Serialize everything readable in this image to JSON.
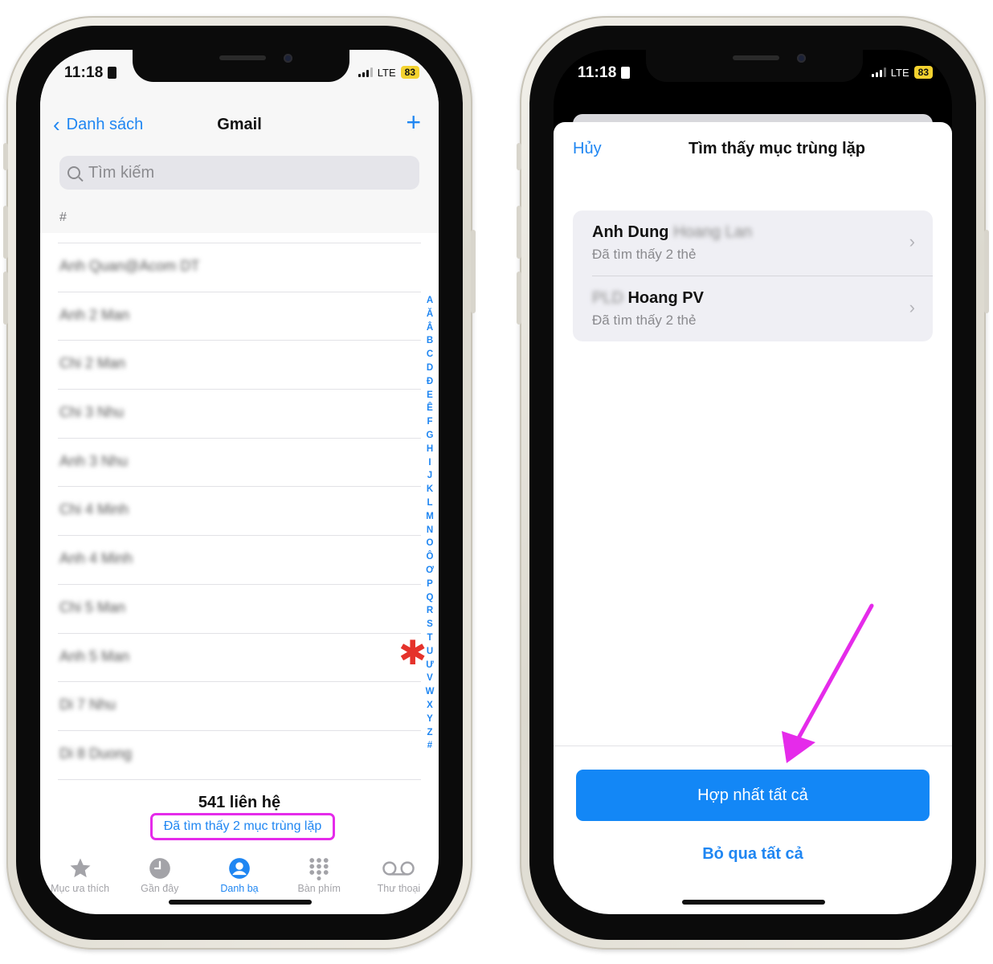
{
  "colors": {
    "accent": "#1f86f2",
    "merge_button": "#1387f6",
    "highlight_box": "#e52bea",
    "arrow": "#e52bea",
    "favorite_marker": "#e5322b",
    "battery_fill": "#f3d22f"
  },
  "left_phone": {
    "status": {
      "time": "11:18",
      "network": "LTE",
      "battery": "83"
    },
    "nav": {
      "back_label": "Danh sách",
      "title": "Gmail",
      "add_icon": "plus-icon"
    },
    "search": {
      "placeholder": "Tìm kiếm",
      "icon": "search-icon"
    },
    "section_header": "#",
    "contacts": [
      {
        "name": "Anh Quan@Acom DT"
      },
      {
        "name": "Anh 2 Man"
      },
      {
        "name": "Chi 2 Man"
      },
      {
        "name": "Chi 3 Nhu"
      },
      {
        "name": "Anh 3 Nhu"
      },
      {
        "name": "Chi 4 Minh"
      },
      {
        "name": "Anh 4 Minh"
      },
      {
        "name": "Chi 5 Man"
      },
      {
        "name": "Anh 5 Man"
      },
      {
        "name": "Di 7 Nhu"
      },
      {
        "name": "Di 8 Duong"
      }
    ],
    "alpha_index": [
      "A",
      "Ă",
      "Â",
      "B",
      "C",
      "D",
      "Đ",
      "E",
      "Ê",
      "F",
      "G",
      "H",
      "I",
      "J",
      "K",
      "L",
      "M",
      "N",
      "O",
      "Ô",
      "Ơ",
      "P",
      "Q",
      "R",
      "S",
      "T",
      "U",
      "Ư",
      "V",
      "W",
      "X",
      "Y",
      "Z",
      "#"
    ],
    "contact_count": "541 liên hệ",
    "duplicates_link": "Đã tìm thấy 2 mục trùng lặp",
    "tabs": [
      {
        "label": "Mục ưa thích",
        "icon": "star-icon",
        "active": false
      },
      {
        "label": "Gần đây",
        "icon": "clock-icon",
        "active": false
      },
      {
        "label": "Danh bạ",
        "icon": "person-circle-icon",
        "active": true
      },
      {
        "label": "Bàn phím",
        "icon": "keypad-icon",
        "active": false
      },
      {
        "label": "Thư thoại",
        "icon": "voicemail-icon",
        "active": false
      }
    ]
  },
  "right_phone": {
    "status": {
      "time": "11:18",
      "network": "LTE",
      "battery": "83"
    },
    "sheet": {
      "cancel_label": "Hủy",
      "title": "Tìm thấy mục trùng lặp",
      "duplicates": [
        {
          "name_visible": "Anh Dung",
          "name_blurred": "Hoang Lan",
          "subtitle": "Đã tìm thấy 2 thẻ"
        },
        {
          "name_blurred": "PLD",
          "name_visible": "Hoang PV",
          "subtitle": "Đã tìm thấy 2 thẻ"
        }
      ],
      "merge_all_label": "Hợp nhất tất cả",
      "skip_all_label": "Bỏ qua tất cả"
    }
  }
}
